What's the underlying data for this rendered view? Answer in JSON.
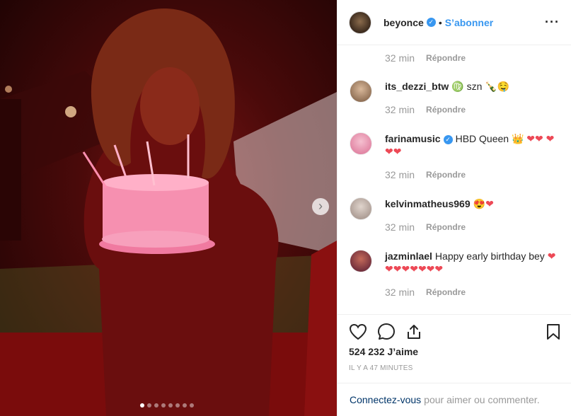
{
  "post": {
    "image_description_icon": "photo",
    "carousel_count": 8,
    "carousel_active": 0
  },
  "header": {
    "username": "beyonce",
    "separator": "•",
    "follow_label": "S’abonner",
    "more_label": "···"
  },
  "first_meta": {
    "time": "32 min",
    "reply": "Répondre"
  },
  "comments": [
    {
      "user": "its_dezzi_btw",
      "text": "♍ szn 🍾🤤",
      "time": "32 min",
      "reply": "Répondre"
    },
    {
      "user": "farinamusic",
      "verified": true,
      "text": "HBD Queen 👑 ❤❤ ❤❤❤",
      "time": "32 min",
      "reply": "Répondre"
    },
    {
      "user": "kelvinmatheus969",
      "text": "😍❤",
      "time": "32 min",
      "reply": "Répondre"
    },
    {
      "user": "jazminlael",
      "text": "Happy early birthday bey ❤❤❤❤❤❤❤❤",
      "time": "32 min",
      "reply": "Répondre"
    }
  ],
  "actions": {
    "likes": "524 232 J’aime",
    "time_ago": "IL Y A 47 MINUTES"
  },
  "footer": {
    "link": "Connectez-vous",
    "text": "pour aimer ou commenter."
  },
  "colors": {
    "accent": "#3897f0",
    "heart": "#ed4956"
  }
}
